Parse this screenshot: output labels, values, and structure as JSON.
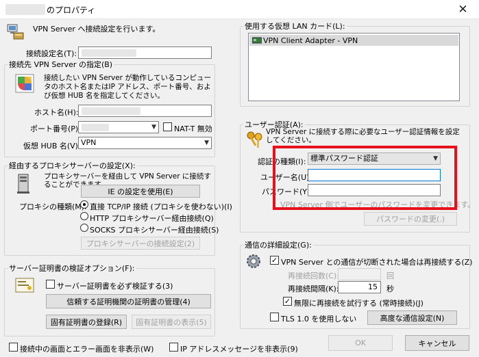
{
  "window": {
    "title": "のプロパティ"
  },
  "left": {
    "intro": "VPN Server へ接続設定を行います。",
    "setting_name_label": "接続設定名(T):",
    "dest": {
      "legend": "接続先 VPN Server の指定(B)",
      "desc": "接続したい VPN Server が動作しているコンピュータのホスト名またはIP アドレス、ポート番号、および仮想 HUB 名を指定してください。",
      "host_label": "ホスト名(H):",
      "port_label": "ポート番号(P):",
      "nat_t_label": "NAT-T 無効",
      "hub_label": "仮想 HUB 名(V):",
      "hub_value": "VPN"
    },
    "proxy": {
      "legend": "経由するプロキシサーバーの設定(X):",
      "desc": "プロキシサーバーを経由して VPN Server に接続することができます。",
      "ie_button": "IE の設定を使用(E)",
      "type_label": "プロキシの種類(M):",
      "options": [
        "直接 TCP/IP 接続 (プロキシを使わない)(I)",
        "HTTP プロキシサーバー経由接続(Q)",
        "SOCKS プロキシサーバー経由接続(S)"
      ],
      "settings_button": "プロキシサーバーの接続設定(2)"
    },
    "cert": {
      "legend": "サーバー証明書の検証オプション(F):",
      "always_verify": "サーバー証明書を必ず検証する(3)",
      "manage_button": "信頼する証明機関の証明書の管理(4)",
      "register_button": "固有証明書の登録(R)",
      "show_button": "固有証明書の表示(5)"
    }
  },
  "right": {
    "adapter": {
      "legend": "使用する仮想 LAN カード(L):",
      "items": [
        "VPN Client Adapter - VPN"
      ]
    },
    "auth": {
      "legend": "ユーザー認証(A):",
      "desc": "VPN Server に接続する際に必要なユーザー認証情報を設定してください。",
      "type_label": "認証の種類(I):",
      "type_value": "標準パスワード認証",
      "user_label": "ユーザー名(U):",
      "password_label": "パスワード(Y):",
      "note": "VPN Server 側でユーザーのパスワードを変更できます。",
      "change_button": "パスワードの変更(.)"
    },
    "advanced": {
      "legend": "通信の詳細設定(G):",
      "reconnect_label": "VPN Server との通信が切断された場合は再接続する(Z)",
      "retry_count_label": "再接続回数(C):",
      "retry_count_unit": "回",
      "interval_label": "再接続間隔(K):",
      "interval_value": "15",
      "interval_unit": "秒",
      "infinite_label": "無限に再接続を試行する (常時接続)(J)",
      "no_tls_label": "TLS 1.0 を使用しない",
      "advanced_button": "高度な通信設定(N)"
    }
  },
  "bottom": {
    "hide_status": "接続中の画面とエラー画面を非表示(W)",
    "hide_ip": "IP アドレスメッセージを非表示(9)",
    "ok_button": "OK",
    "cancel_button": "キャンセル"
  }
}
